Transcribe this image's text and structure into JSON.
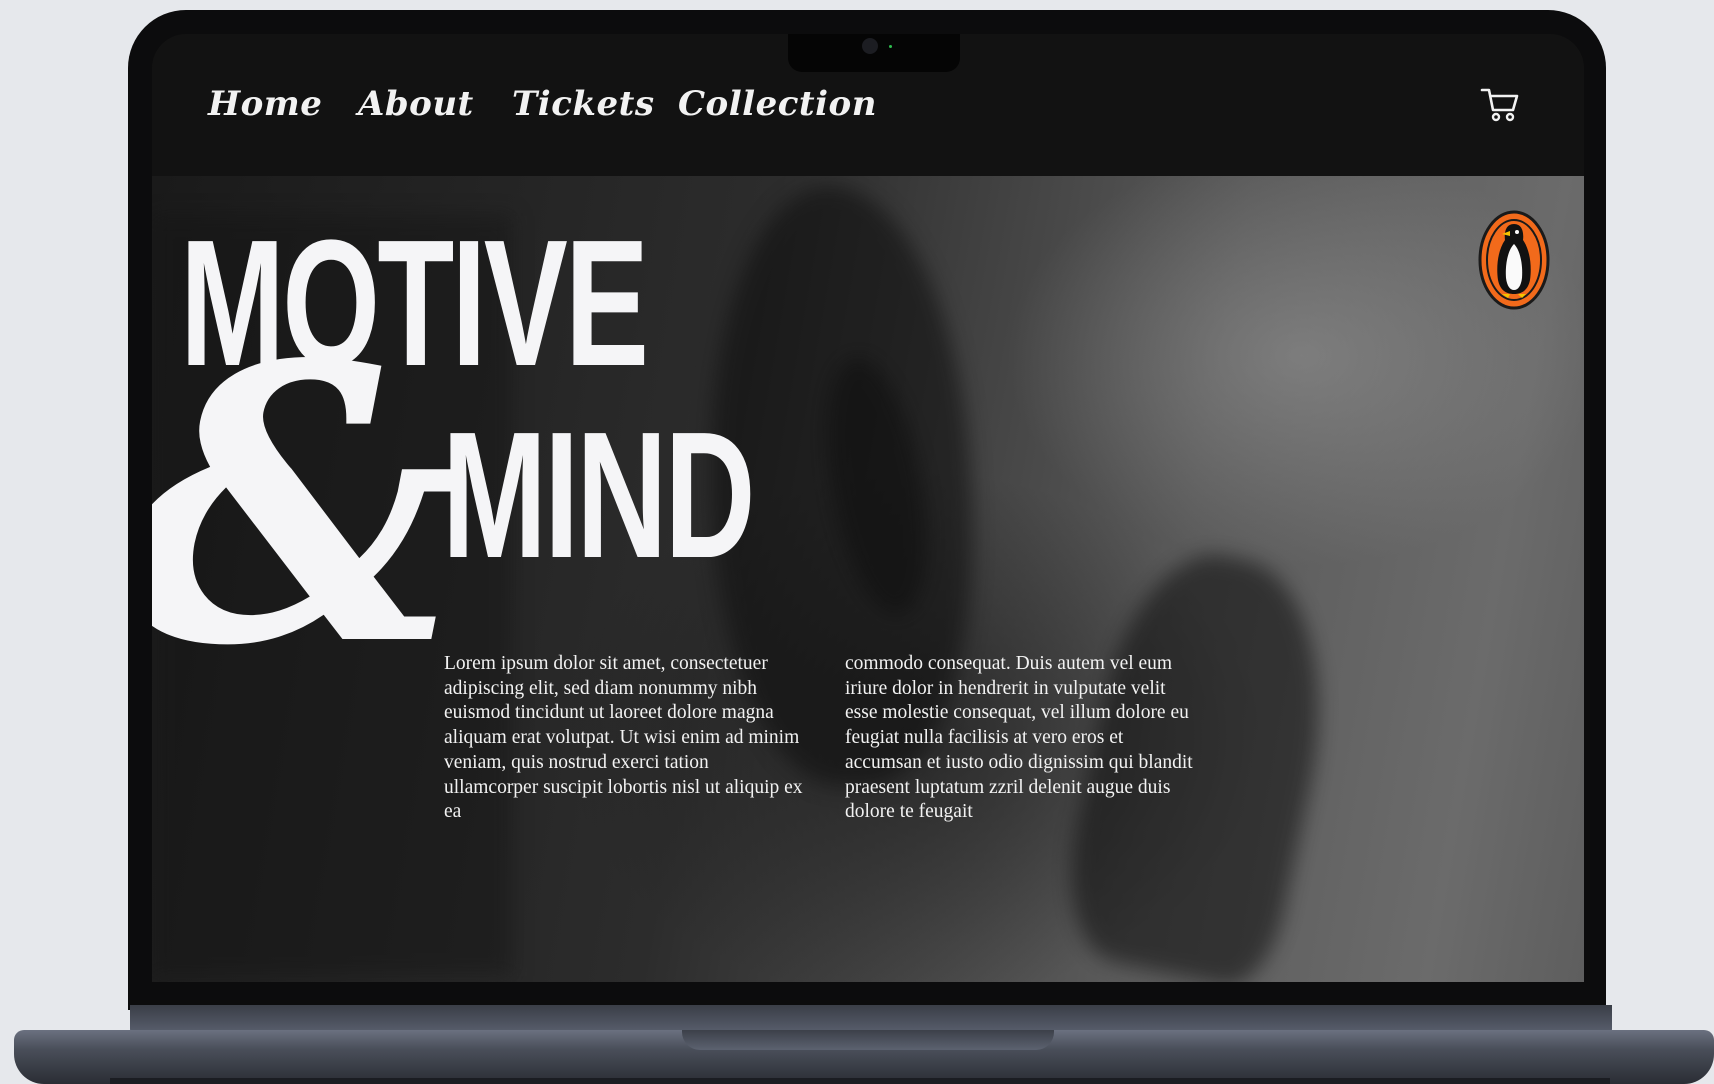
{
  "nav": {
    "items": [
      {
        "label": "Home"
      },
      {
        "label": "About"
      },
      {
        "label": "Tickets"
      },
      {
        "label": "Collection"
      }
    ],
    "cart_icon": "shopping-cart-icon"
  },
  "hero": {
    "title_line1": "MOTIVE",
    "ampersand": "&",
    "title_line2": "MIND",
    "column1": "Lorem ipsum dolor sit amet, consectetuer adipiscing elit, sed diam nonummy nibh euismod tincidunt ut laoreet dolore magna aliquam erat volutpat. Ut wisi enim ad minim veniam, quis nostrud exerci tation ullamcorper suscipit lobortis nisl ut aliquip ex ea",
    "column2": "commodo consequat. Duis autem vel eum iriure dolor in hendrerit in vulputate velit esse molestie consequat, vel illum dolore eu feugiat nulla facilisis at vero eros et accumsan et iusto odio dignissim qui blandit praesent luptatum zzril delenit augue duis dolore te feugait",
    "logo_icon": "penguin-logo-icon"
  },
  "colors": {
    "nav_bg": "#121212",
    "text": "#f5f5f7",
    "logo_orange": "#f26a1b"
  }
}
